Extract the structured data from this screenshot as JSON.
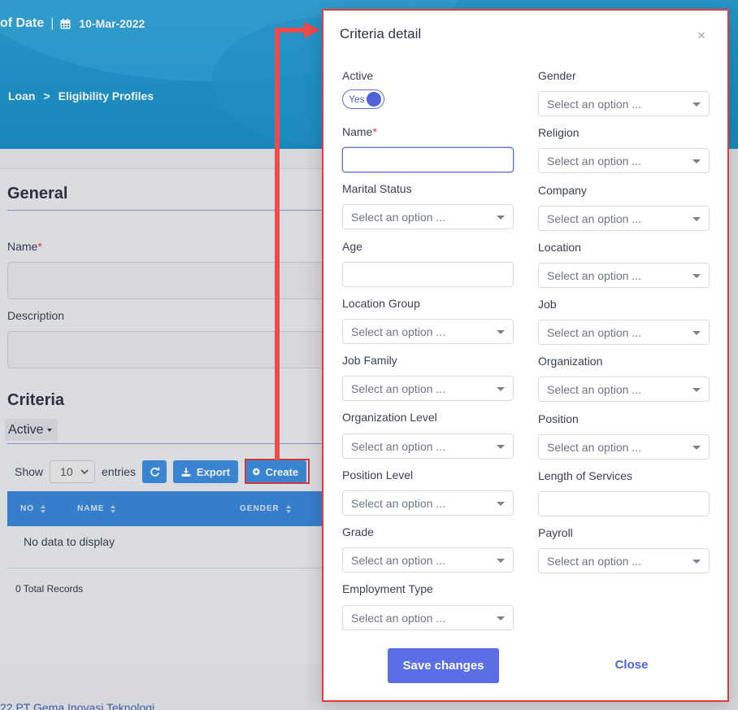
{
  "header": {
    "date_label": "of Date",
    "date_sep": "|",
    "date_value": "10-Mar-2022",
    "breadcrumb": [
      "Loan",
      ">",
      "Eligibility Profiles"
    ]
  },
  "general": {
    "title": "General",
    "name_label": "Name",
    "required_mark": "*",
    "description_label": "Description"
  },
  "criteria": {
    "title": "Criteria",
    "filter_label": "Active",
    "show_label": "Show",
    "page_length": "10",
    "entries_label": "entries",
    "export_label": "Export",
    "create_label": "Create",
    "columns": [
      "NO",
      "NAME",
      "GENDER"
    ],
    "empty_text": "No data to display",
    "total_text": "0 Total Records"
  },
  "footer": {
    "text": "22 PT Gema Inovasi Teknologi"
  },
  "modal": {
    "title": "Criteria detail",
    "close_x": "×",
    "active_label": "Active",
    "toggle_text": "Yes",
    "name_label": "Name",
    "required_mark": "*",
    "placeholder": "Select an option ...",
    "left_fields": {
      "marital_status": "Marital Status",
      "age": "Age",
      "location_group": "Location Group",
      "job_family": "Job Family",
      "organization_level": "Organization Level",
      "position_level": "Position Level",
      "grade": "Grade",
      "employment_type": "Employment Type"
    },
    "right_fields": {
      "gender": "Gender",
      "religion": "Religion",
      "company": "Company",
      "location": "Location",
      "job": "Job",
      "organization": "Organization",
      "position": "Position",
      "length_of_services": "Length of Services",
      "payroll": "Payroll"
    },
    "save_label": "Save changes",
    "close_label": "Close"
  },
  "colors": {
    "header_blue": "#1e95cd",
    "table_header": "#3a86d9",
    "primary": "#5b6ee6",
    "highlight_red": "#e23b3b"
  }
}
